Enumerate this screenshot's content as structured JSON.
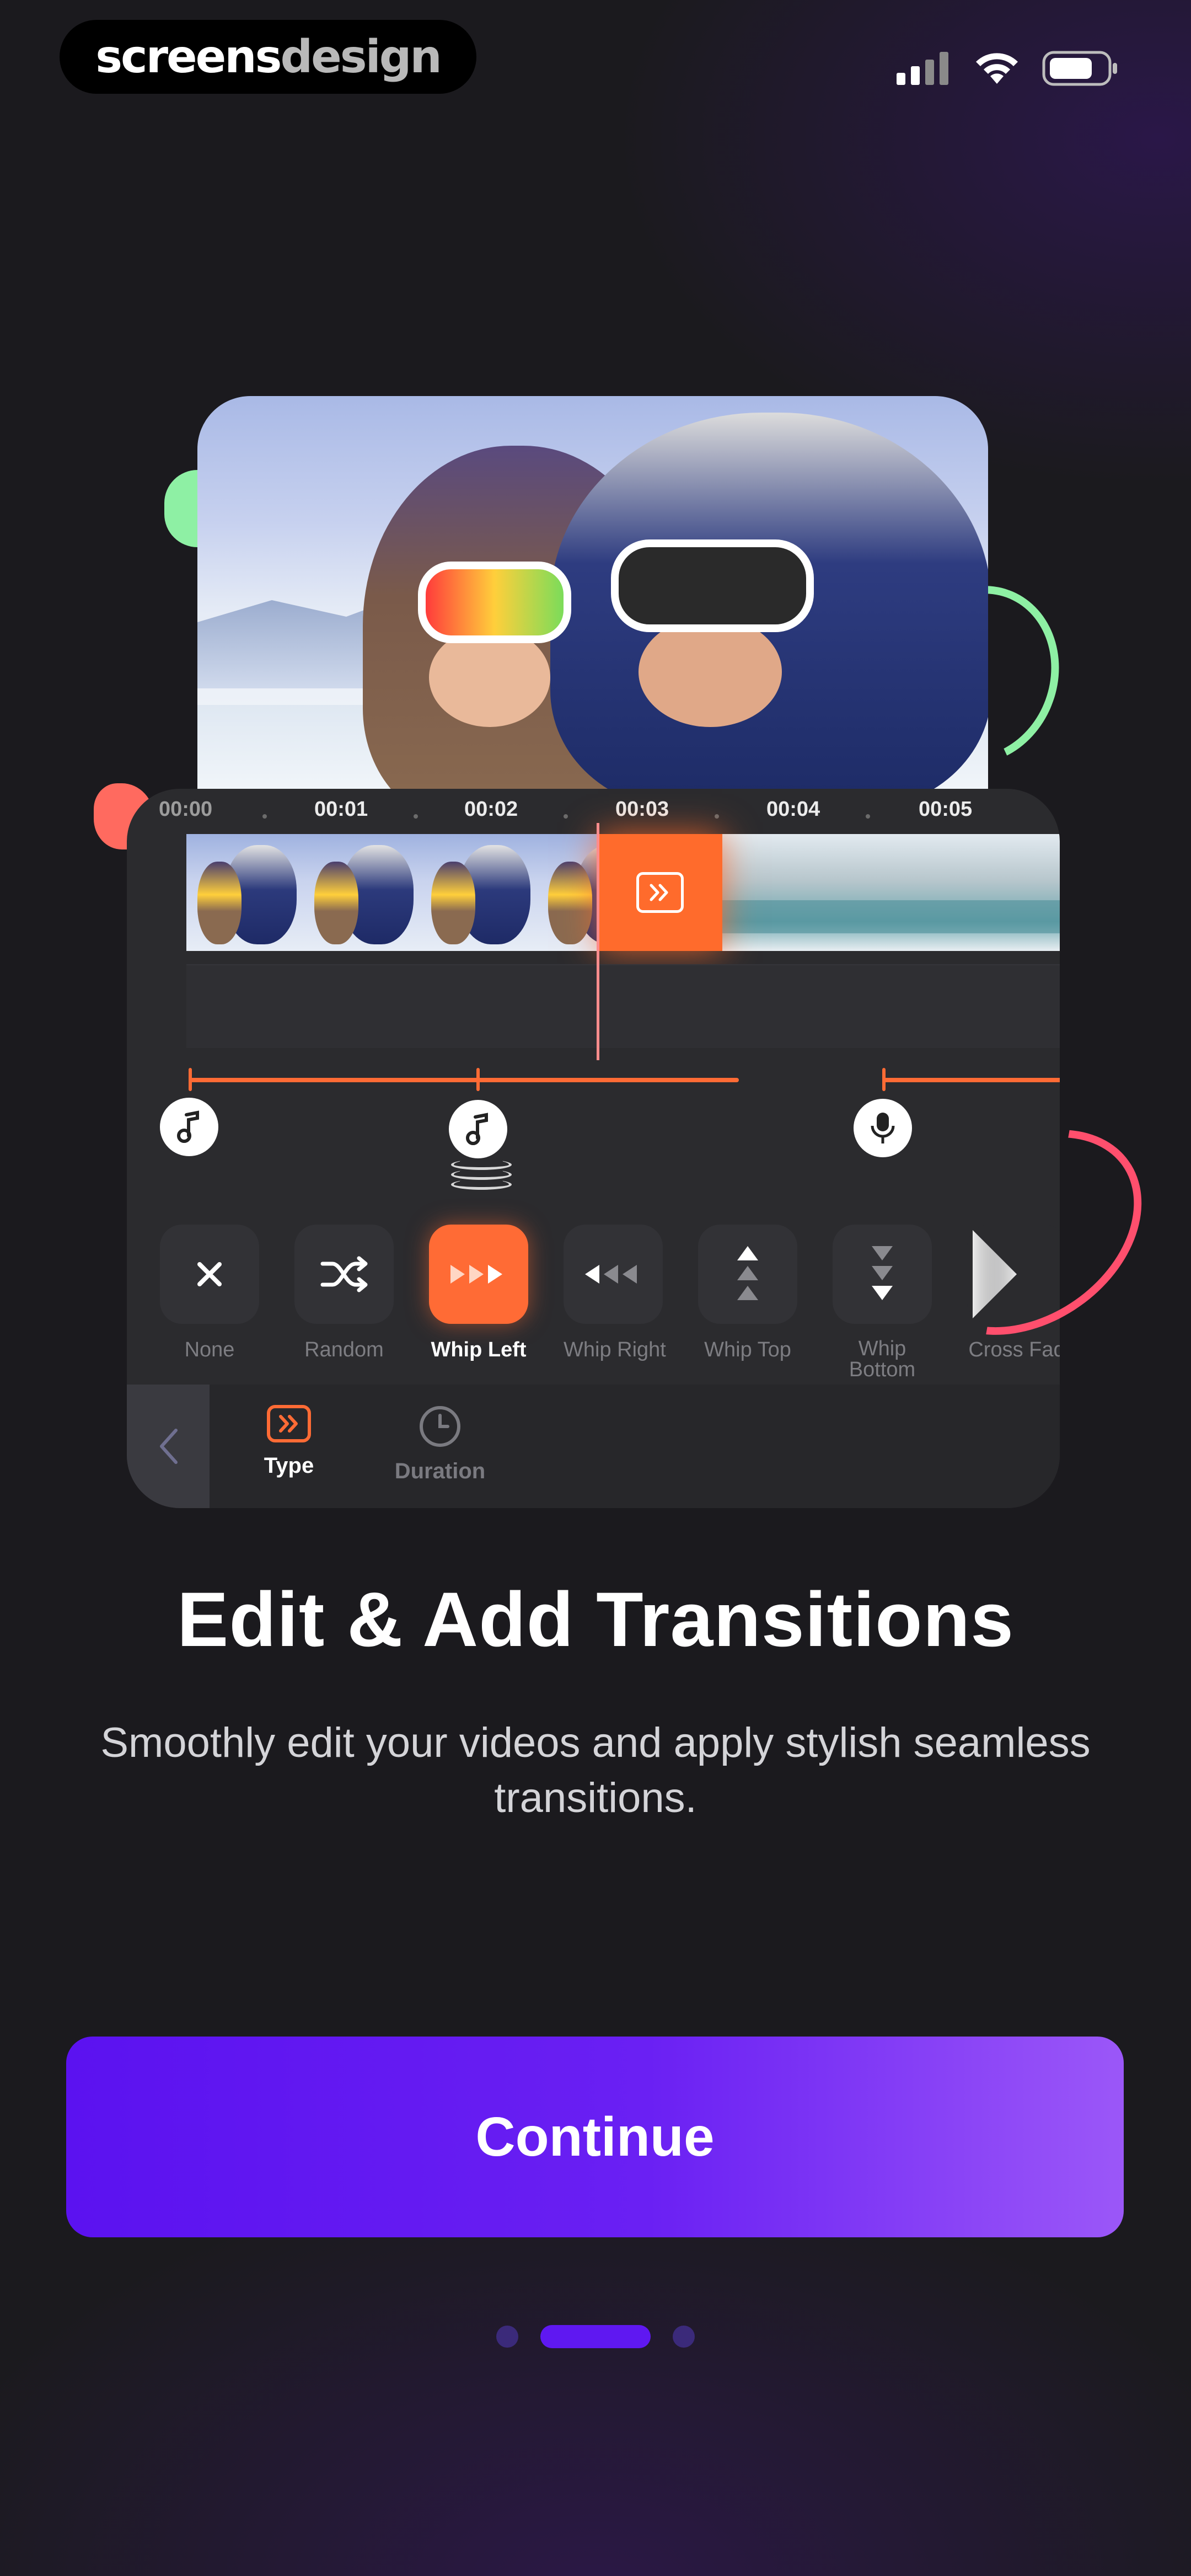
{
  "brand": {
    "part1": "screens",
    "part2": "design"
  },
  "status_bar": {
    "signal_icon": "signal-bars-icon",
    "wifi_icon": "wifi-icon",
    "battery_icon": "battery-icon"
  },
  "editor": {
    "timeline_ticks": [
      "00:00",
      "00:01",
      "00:02",
      "00:03",
      "00:04",
      "00:05"
    ],
    "transition_icon": "double-chevron-right-icon",
    "audio_icons": [
      "music-note-icon",
      "music-note-stack-icon",
      "microphone-icon"
    ],
    "options": [
      {
        "label": "None",
        "icon": "close-icon"
      },
      {
        "label": "Random",
        "icon": "shuffle-icon"
      },
      {
        "label": "Whip Left",
        "icon": "fast-forward-icon"
      },
      {
        "label": "Whip Right",
        "icon": "rewind-icon"
      },
      {
        "label": "Whip Top",
        "icon": "arrows-up-icon"
      },
      {
        "label": "Whip Bottom",
        "icon": "arrows-down-icon"
      },
      {
        "label": "Cross Fad",
        "icon": "cross-fade-icon"
      }
    ],
    "selected_option": "Whip Left",
    "bottom_tabs": [
      {
        "label": "Type",
        "icon": "transition-type-icon"
      },
      {
        "label": "Duration",
        "icon": "clock-icon"
      }
    ]
  },
  "onboarding": {
    "title": "Edit & Add Transitions",
    "subtitle_line1": "Smoothly edit your videos and apply stylish seamless",
    "subtitle_line2": "transitions.",
    "continue_label": "Continue",
    "page_count": 3,
    "current_page": 2
  },
  "colors": {
    "accent_orange": "#ff6b35",
    "cta_purple": "#5b12f0",
    "background": "#1b1a1e"
  }
}
